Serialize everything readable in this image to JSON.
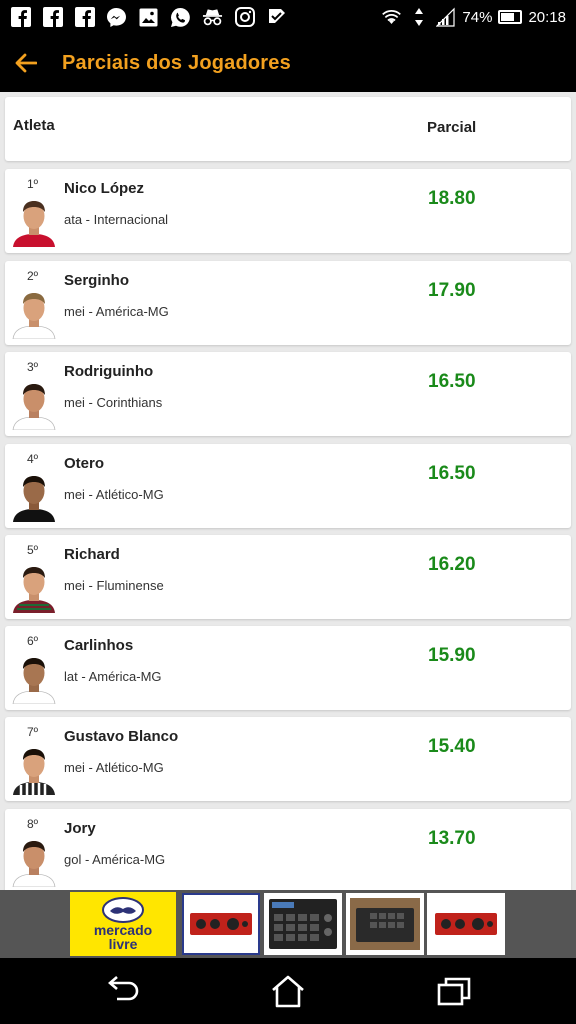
{
  "status_bar": {
    "battery_text": "74%",
    "battery_level": 0.74,
    "time": "20:18",
    "icons": [
      "facebook-icon",
      "facebook-icon",
      "facebook-icon",
      "messenger-icon",
      "gallery-icon",
      "whatsapp-icon",
      "incognito-icon",
      "instagram-icon",
      "check-icon",
      "wifi-icon",
      "data-arrows-icon",
      "signal-icon"
    ]
  },
  "app_bar": {
    "title": "Parciais dos Jogadores",
    "accent_color": "#f3a11f"
  },
  "table_header": {
    "col_athlete": "Atleta",
    "col_score": "Parcial"
  },
  "players": [
    {
      "rank": "1º",
      "name": "Nico López",
      "info": "ata - Internacional",
      "score": "18.80",
      "shirt": "#c8102e"
    },
    {
      "rank": "2º",
      "name": "Serginho",
      "info": "mei - América-MG",
      "score": "17.90",
      "shirt": "#ffffff"
    },
    {
      "rank": "3º",
      "name": "Rodriguinho",
      "info": "mei - Corinthians",
      "score": "16.50",
      "shirt": "#ffffff"
    },
    {
      "rank": "4º",
      "name": "Otero",
      "info": "mei - Atlético-MG",
      "score": "16.50",
      "shirt": "#111111"
    },
    {
      "rank": "5º",
      "name": "Richard",
      "info": "mei - Fluminense",
      "score": "16.20",
      "shirt": "#7a1f2b"
    },
    {
      "rank": "6º",
      "name": "Carlinhos",
      "info": "lat - América-MG",
      "score": "15.90",
      "shirt": "#ffffff"
    },
    {
      "rank": "7º",
      "name": "Gustavo Blanco",
      "info": "mei - Atlético-MG",
      "score": "15.40",
      "shirt": "#222222"
    },
    {
      "rank": "8º",
      "name": "Jory",
      "info": "gol - América-MG",
      "score": "13.70",
      "shirt": "#ffffff"
    }
  ],
  "score_color": "#1a8a1a",
  "ad": {
    "brand_line1": "mercado",
    "brand_line2": "livre",
    "products": [
      "audio-interface-icon",
      "drum-machine-icon",
      "sampler-icon",
      "audio-interface-icon"
    ]
  },
  "nav": [
    "back-nav-icon",
    "home-icon",
    "recents-icon"
  ]
}
